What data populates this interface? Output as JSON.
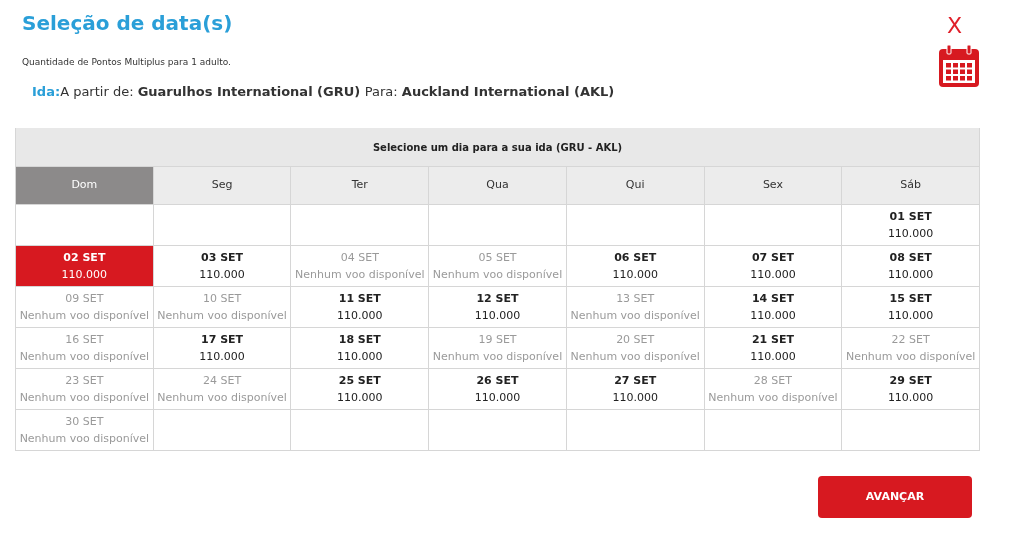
{
  "title": "Seleção de data(s)",
  "close": "X",
  "note": "Quantidade de Pontos Multiplus para 1 adulto.",
  "route": {
    "label": "Ida:",
    "from_label": "A partir de:",
    "from": "Guarulhos International (GRU)",
    "to_label": "Para:",
    "to": "Auckland International (AKL)"
  },
  "calendar": {
    "caption": "Selecione um dia para a sua ida (GRU - AKL)",
    "days": [
      {
        "label": "Dom",
        "selected": true
      },
      {
        "label": "Seg",
        "selected": false
      },
      {
        "label": "Ter",
        "selected": false
      },
      {
        "label": "Qua",
        "selected": false
      },
      {
        "label": "Qui",
        "selected": false
      },
      {
        "label": "Sex",
        "selected": false
      },
      {
        "label": "Sáb",
        "selected": false
      }
    ],
    "weeks": [
      [
        {
          "kind": "blank"
        },
        {
          "kind": "blank"
        },
        {
          "kind": "blank"
        },
        {
          "kind": "blank"
        },
        {
          "kind": "blank"
        },
        {
          "kind": "blank"
        },
        {
          "kind": "day",
          "date": "01 SET",
          "info": "110.000",
          "available": true,
          "selected": false
        }
      ],
      [
        {
          "date": "02 SET",
          "info": "110.000",
          "available": true,
          "selected": true
        },
        {
          "date": "03 SET",
          "info": "110.000",
          "available": true,
          "selected": false
        },
        {
          "date": "04 SET",
          "info": "Nenhum voo disponível",
          "available": false,
          "selected": false
        },
        {
          "date": "05 SET",
          "info": "Nenhum voo disponível",
          "available": false,
          "selected": false
        },
        {
          "date": "06 SET",
          "info": "110.000",
          "available": true,
          "selected": false
        },
        {
          "date": "07 SET",
          "info": "110.000",
          "available": true,
          "selected": false
        },
        {
          "date": "08 SET",
          "info": "110.000",
          "available": true,
          "selected": false
        }
      ],
      [
        {
          "date": "09 SET",
          "info": "Nenhum voo disponível",
          "available": false,
          "selected": false
        },
        {
          "date": "10 SET",
          "info": "Nenhum voo disponível",
          "available": false,
          "selected": false
        },
        {
          "date": "11 SET",
          "info": "110.000",
          "available": true,
          "selected": false
        },
        {
          "date": "12 SET",
          "info": "110.000",
          "available": true,
          "selected": false
        },
        {
          "date": "13 SET",
          "info": "Nenhum voo disponível",
          "available": false,
          "selected": false
        },
        {
          "date": "14 SET",
          "info": "110.000",
          "available": true,
          "selected": false
        },
        {
          "date": "15 SET",
          "info": "110.000",
          "available": true,
          "selected": false
        }
      ],
      [
        {
          "date": "16 SET",
          "info": "Nenhum voo disponível",
          "available": false,
          "selected": false
        },
        {
          "date": "17 SET",
          "info": "110.000",
          "available": true,
          "selected": false
        },
        {
          "date": "18 SET",
          "info": "110.000",
          "available": true,
          "selected": false
        },
        {
          "date": "19 SET",
          "info": "Nenhum voo disponível",
          "available": false,
          "selected": false
        },
        {
          "date": "20 SET",
          "info": "Nenhum voo disponível",
          "available": false,
          "selected": false
        },
        {
          "date": "21 SET",
          "info": "110.000",
          "available": true,
          "selected": false
        },
        {
          "date": "22 SET",
          "info": "Nenhum voo disponível",
          "available": false,
          "selected": false
        }
      ],
      [
        {
          "date": "23 SET",
          "info": "Nenhum voo disponível",
          "available": false,
          "selected": false
        },
        {
          "date": "24 SET",
          "info": "Nenhum voo disponível",
          "available": false,
          "selected": false
        },
        {
          "date": "25 SET",
          "info": "110.000",
          "available": true,
          "selected": false
        },
        {
          "date": "26 SET",
          "info": "110.000",
          "available": true,
          "selected": false
        },
        {
          "date": "27 SET",
          "info": "110.000",
          "available": true,
          "selected": false
        },
        {
          "date": "28 SET",
          "info": "Nenhum voo disponível",
          "available": false,
          "selected": false
        },
        {
          "date": "29 SET",
          "info": "110.000",
          "available": true,
          "selected": false
        }
      ],
      [
        {
          "date": "30 SET",
          "info": "Nenhum voo disponível",
          "available": false,
          "selected": false
        },
        {
          "kind": "blank"
        },
        {
          "kind": "blank"
        },
        {
          "kind": "blank"
        },
        {
          "kind": "blank"
        },
        {
          "kind": "blank"
        },
        {
          "kind": "blank"
        }
      ]
    ]
  },
  "next_button": "AVANÇAR"
}
